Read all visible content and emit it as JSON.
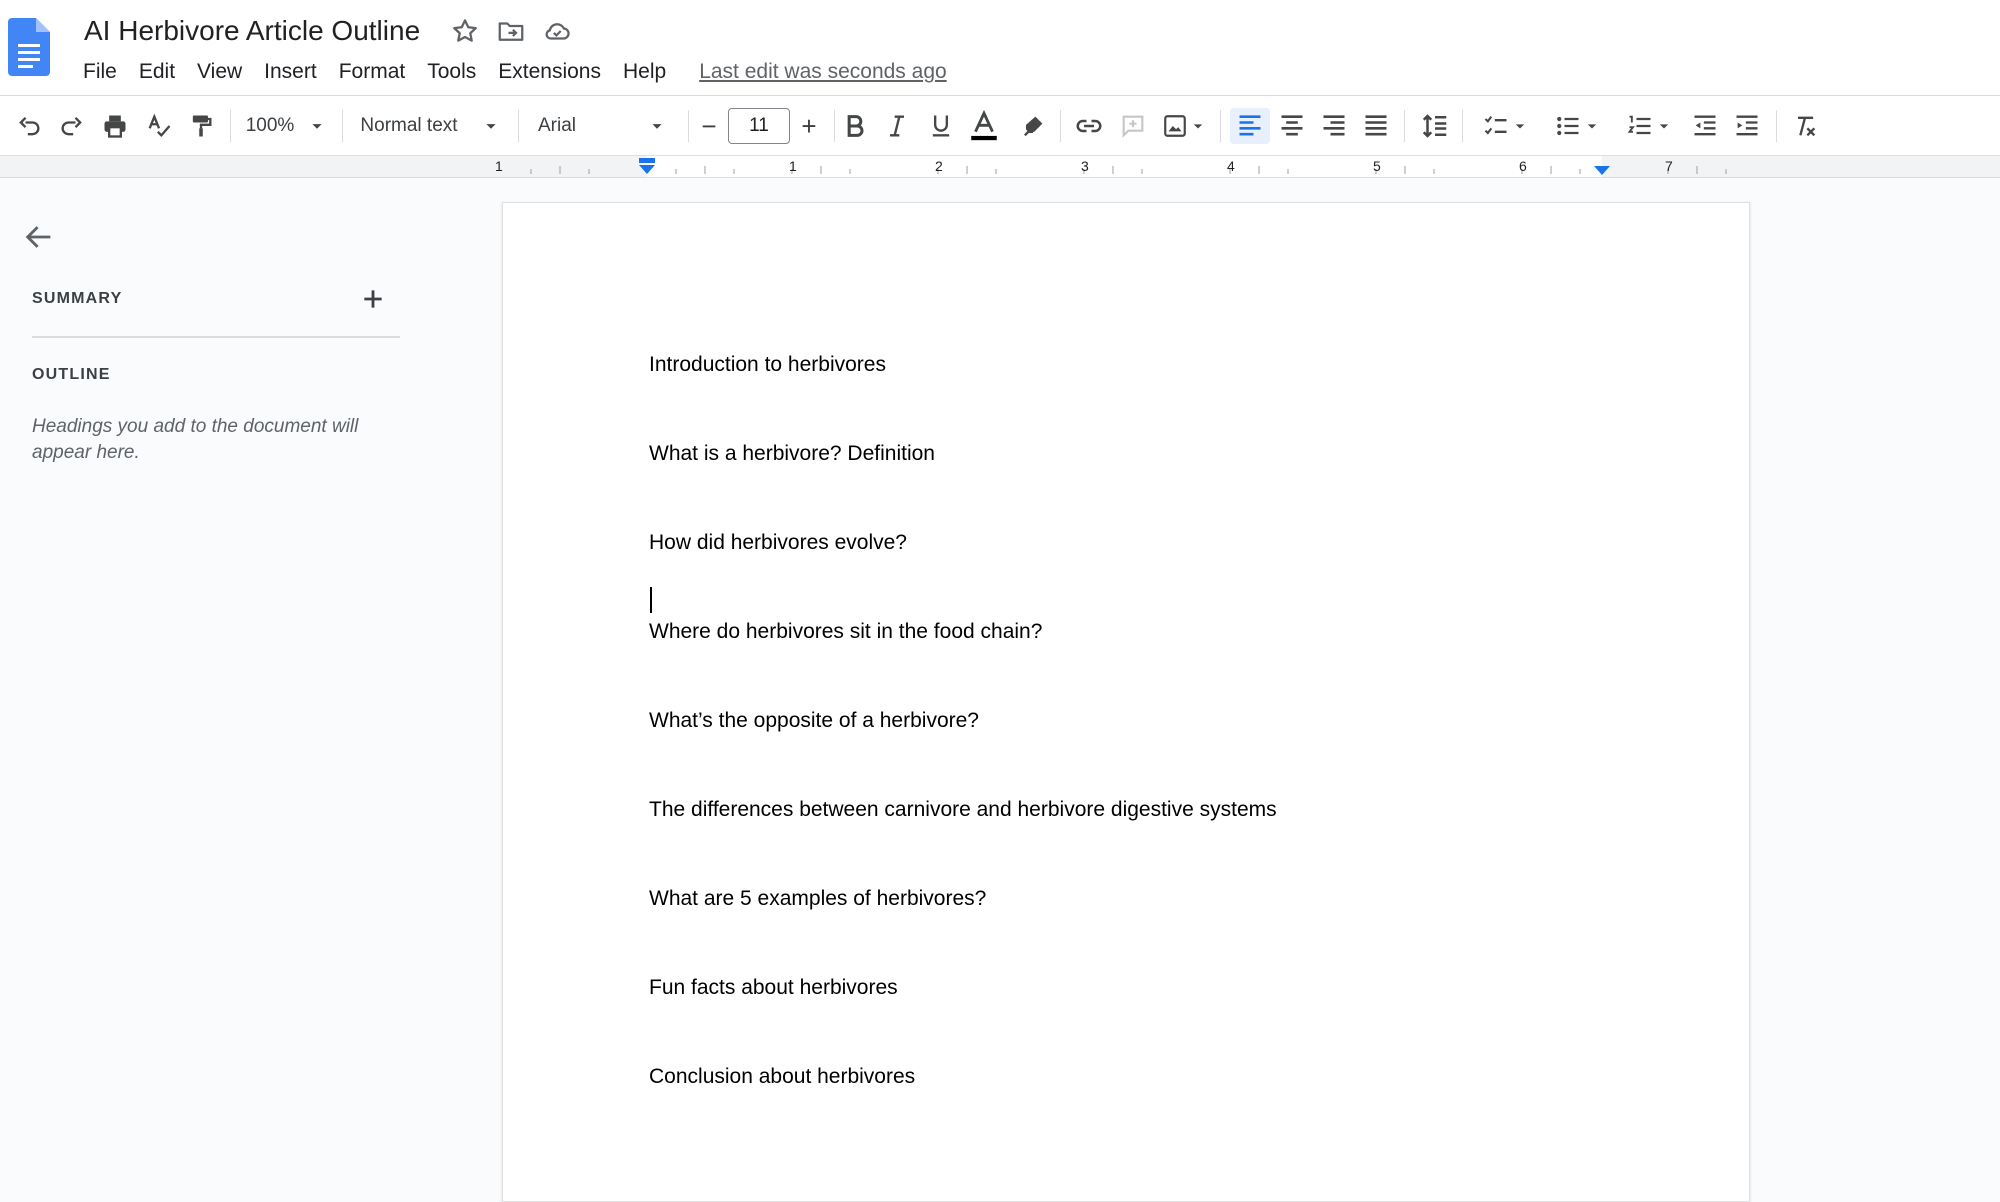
{
  "header": {
    "title": "AI Herbivore Article Outline",
    "icons": [
      "docs-logo-icon",
      "star-icon",
      "move-folder-icon",
      "cloud-saved-icon"
    ],
    "menu": [
      "File",
      "Edit",
      "View",
      "Insert",
      "Format",
      "Tools",
      "Extensions",
      "Help"
    ],
    "last_edit": "Last edit was seconds ago"
  },
  "toolbar": {
    "zoom": "100%",
    "style": "Normal text",
    "font": "Arial",
    "font_size": "11",
    "minus": "−",
    "plus": "+",
    "text_color": "#000000",
    "accent": "#1a73e8"
  },
  "ruler": {
    "labels": [
      "1",
      "1",
      "2",
      "3",
      "4",
      "5",
      "6",
      "7"
    ]
  },
  "sidebar": {
    "summary_label": "SUMMARY",
    "outline_label": "OUTLINE",
    "outline_hint": "Headings you add to the document will appear here."
  },
  "document": {
    "paragraphs": [
      "Introduction to herbivores",
      "What is a herbivore? Definition",
      "How did herbivores evolve?",
      "Where do herbivores sit in the food chain?",
      "What’s the opposite of a herbivore?",
      "The differences between carnivore and herbivore digestive systems",
      "What are 5 examples of herbivores?",
      "Fun facts about herbivores",
      "Conclusion about herbivores"
    ]
  }
}
